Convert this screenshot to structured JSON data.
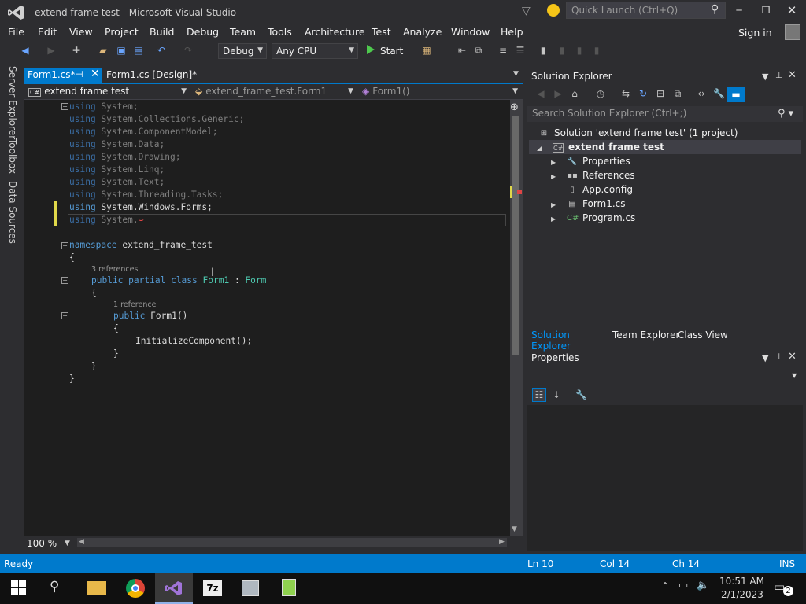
{
  "window": {
    "title": "extend frame test - Microsoft Visual Studio",
    "quick_launch_placeholder": "Quick Launch (Ctrl+Q)",
    "sign_in": "Sign in"
  },
  "menu": [
    "File",
    "Edit",
    "View",
    "Project",
    "Build",
    "Debug",
    "Team",
    "Tools",
    "Architecture",
    "Test",
    "Analyze",
    "Window",
    "Help"
  ],
  "toolbar": {
    "config": "Debug",
    "platform": "Any CPU",
    "start": "Start"
  },
  "left_sidebar": [
    "Server Explorer",
    "Toolbox",
    "Data Sources"
  ],
  "tabs": [
    {
      "label": "Form1.cs*",
      "active": true
    },
    {
      "label": "Form1.cs [Design]*",
      "active": false
    }
  ],
  "navbar": {
    "project": "extend frame test",
    "class": "extend_frame_test.Form1",
    "member": "Form1()"
  },
  "code": {
    "usings": [
      "System",
      "System.Collections.Generic",
      "System.ComponentModel",
      "System.Data",
      "System.Drawing",
      "System.Linq",
      "System.Text",
      "System.Threading.Tasks",
      "System.Windows.Forms"
    ],
    "current_line": "System.",
    "namespace_name": "extend_frame_test",
    "class_refs": "3 references",
    "class_name": "Form1",
    "base_class": "Form",
    "ctor_refs": "1 reference",
    "ctor_name": "Form1()",
    "ctor_body": "InitializeComponent();"
  },
  "editor_zoom": "100 %",
  "solution_explorer": {
    "title": "Solution Explorer",
    "search_placeholder": "Search Solution Explorer (Ctrl+;)",
    "solution": "Solution 'extend frame test' (1 project)",
    "project": "extend frame test",
    "items": [
      "Properties",
      "References",
      "App.config",
      "Form1.cs",
      "Program.cs"
    ],
    "bottom_tabs": [
      "Solution Explorer",
      "Team Explorer",
      "Class View"
    ]
  },
  "properties": {
    "title": "Properties"
  },
  "status": {
    "ready": "Ready",
    "ln": "Ln 10",
    "col": "Col 14",
    "ch": "Ch 14",
    "mode": "INS"
  },
  "taskbar": {
    "time": "10:51 AM",
    "date": "2/1/2023",
    "notifications": "2",
    "sevenzip": "7z"
  },
  "colors": {
    "accent": "#007acc",
    "keyword": "#569cd6",
    "type": "#4ec9b0"
  }
}
